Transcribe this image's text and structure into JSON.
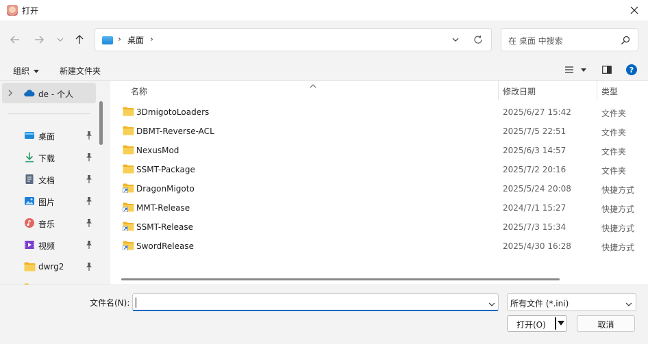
{
  "window": {
    "title": "打开",
    "close_icon": "close-icon"
  },
  "nav": {
    "address": {
      "location_icon": "desktop-icon",
      "crumb": "桌面"
    },
    "search": {
      "placeholder": "在 桌面 中搜索"
    }
  },
  "commandbar": {
    "organize_label": "组织",
    "new_folder_label": "新建文件夹"
  },
  "sidebar": {
    "top_item": "de - 个人",
    "items": [
      {
        "label": "桌面",
        "icon": "desktop-icon"
      },
      {
        "label": "下载",
        "icon": "download-icon"
      },
      {
        "label": "文档",
        "icon": "document-icon"
      },
      {
        "label": "图片",
        "icon": "pictures-icon"
      },
      {
        "label": "音乐",
        "icon": "music-icon"
      },
      {
        "label": "视频",
        "icon": "video-icon"
      },
      {
        "label": "dwrg2",
        "icon": "folder-icon"
      }
    ]
  },
  "filelist": {
    "columns": {
      "name": "名称",
      "date": "修改日期",
      "type": "类型"
    },
    "rows": [
      {
        "name": "3DmigotoLoaders",
        "date": "2025/6/27 15:42",
        "type": "文件夹",
        "icon": "folder-icon"
      },
      {
        "name": "DBMT-Reverse-ACL",
        "date": "2025/7/5 22:51",
        "type": "文件夹",
        "icon": "folder-icon"
      },
      {
        "name": "NexusMod",
        "date": "2025/6/3 14:57",
        "type": "文件夹",
        "icon": "folder-icon"
      },
      {
        "name": "SSMT-Package",
        "date": "2025/7/2 20:16",
        "type": "文件夹",
        "icon": "folder-icon"
      },
      {
        "name": "DragonMigoto",
        "date": "2025/5/24 20:08",
        "type": "快捷方式",
        "icon": "shortcut-folder-icon"
      },
      {
        "name": "MMT-Release",
        "date": "2024/7/1 15:27",
        "type": "快捷方式",
        "icon": "shortcut-folder-icon"
      },
      {
        "name": "SSMT-Release",
        "date": "2025/7/3 15:34",
        "type": "快捷方式",
        "icon": "shortcut-folder-icon"
      },
      {
        "name": "SwordRelease",
        "date": "2025/4/30 16:28",
        "type": "快捷方式",
        "icon": "shortcut-folder-icon"
      }
    ]
  },
  "bottom": {
    "filename_label": "文件名(N):",
    "filename_value": "",
    "filetype_value": "所有文件 (*.ini)",
    "open_label": "打开(O)",
    "cancel_label": "取消"
  },
  "colors": {
    "accent": "#0067c0",
    "folder": "#f4c542",
    "help": "#0067c0"
  }
}
